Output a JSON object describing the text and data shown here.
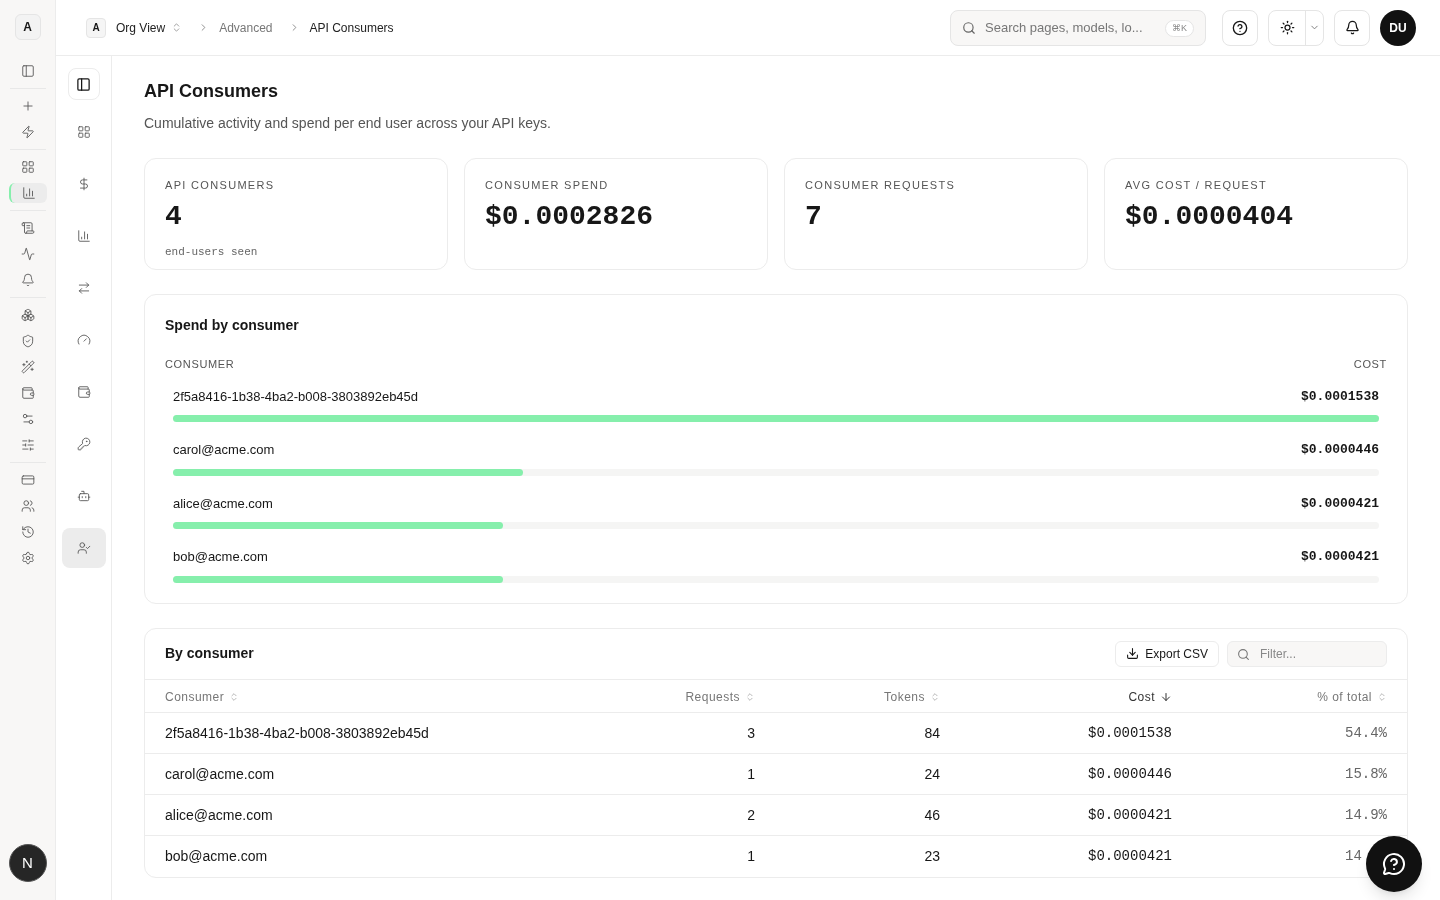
{
  "workspace_badge": "A",
  "rail": [
    {
      "selected": false
    },
    {
      "selected": false
    },
    {
      "selected": false
    },
    {
      "selected": false
    },
    {
      "selected": true
    },
    {
      "selected": false
    },
    {
      "selected": false
    },
    {
      "selected": false
    },
    {
      "selected": false
    },
    {
      "selected": false
    },
    {
      "selected": false
    },
    {
      "selected": false
    },
    {
      "selected": false
    },
    {
      "selected": false
    },
    {
      "selected": false
    },
    {
      "selected": false
    },
    {
      "selected": false
    },
    {
      "selected": false
    }
  ],
  "rail_avatar": "N",
  "subnav": [
    {
      "selected": false
    },
    {
      "selected": false
    },
    {
      "selected": false
    },
    {
      "selected": false
    },
    {
      "selected": false
    },
    {
      "selected": false
    },
    {
      "selected": false
    },
    {
      "selected": false
    },
    {
      "selected": true
    }
  ],
  "breadcrumb": {
    "org_badge": "A",
    "org": "Org View",
    "items": [
      "Advanced",
      "API Consumers"
    ]
  },
  "search": {
    "placeholder": "Search pages, models, lo...",
    "shortcut": "⌘K"
  },
  "user_avatar": "DU",
  "page": {
    "title": "API Consumers",
    "subtitle": "Cumulative activity and spend per end user across your API keys."
  },
  "stats": [
    {
      "label": "API CONSUMERS",
      "value": "4",
      "note": "end-users seen"
    },
    {
      "label": "CONSUMER SPEND",
      "value": "$0.0002826"
    },
    {
      "label": "CONSUMER REQUESTS",
      "value": "7"
    },
    {
      "label": "AVG COST / REQUEST",
      "value": "$0.0000404"
    }
  ],
  "spend": {
    "title": "Spend by consumer",
    "col_left": "CONSUMER",
    "col_right": "COST",
    "rows": [
      {
        "name": "2f5a8416-1b38-4ba2-b008-3803892eb45d",
        "cost": "$0.0001538",
        "level": 1.0
      },
      {
        "name": "carol@acme.com",
        "cost": "$0.0000446",
        "level": 0.29
      },
      {
        "name": "alice@acme.com",
        "cost": "$0.0000421",
        "level": 0.274
      },
      {
        "name": "bob@acme.com",
        "cost": "$0.0000421",
        "level": 0.274
      }
    ]
  },
  "table": {
    "title": "By consumer",
    "export": "Export CSV",
    "filter_placeholder": "Filter...",
    "columns": [
      {
        "label": "Consumer",
        "sorted": false
      },
      {
        "label": "Requests",
        "sorted": false
      },
      {
        "label": "Tokens",
        "sorted": false
      },
      {
        "label": "Cost",
        "sorted": true
      },
      {
        "label": "% of total",
        "sorted": false
      }
    ],
    "rows": [
      [
        "2f5a8416-1b38-4ba2-b008-3803892eb45d",
        "3",
        "84",
        "$0.0001538",
        "54.4%"
      ],
      [
        "carol@acme.com",
        "1",
        "24",
        "$0.0000446",
        "15.8%"
      ],
      [
        "alice@acme.com",
        "2",
        "46",
        "$0.0000421",
        "14.9%"
      ],
      [
        "bob@acme.com",
        "1",
        "23",
        "$0.0000421",
        "14"
      ]
    ]
  }
}
